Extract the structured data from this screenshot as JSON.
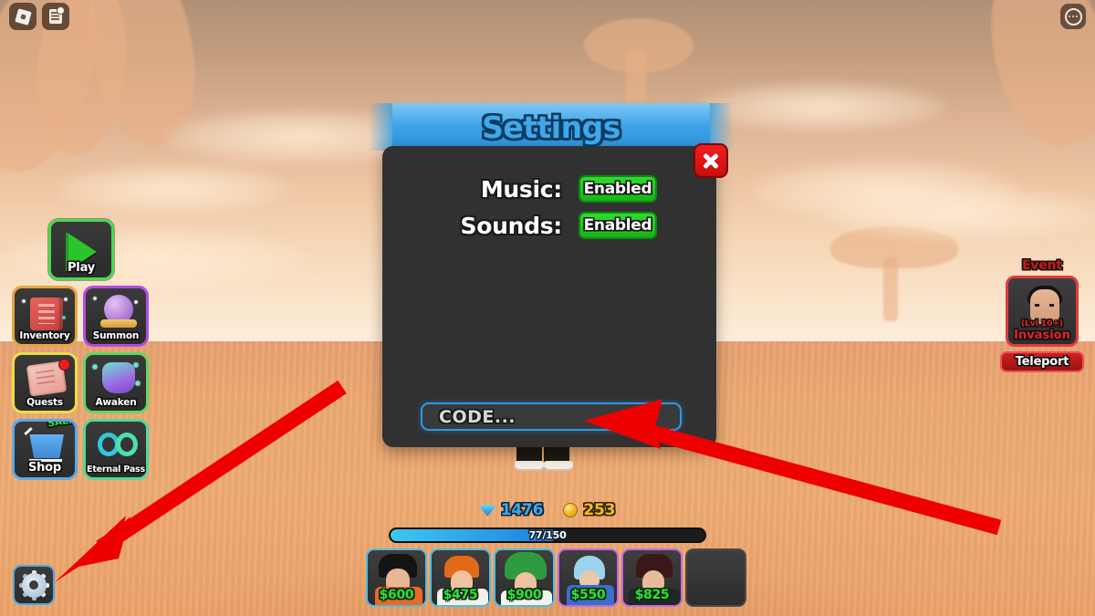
{
  "window": {
    "game_genre": "roblox-anime-tower-defense",
    "topbar": {
      "roblox_logo": "roblox-logo-icon",
      "chat_icon": "chat-icon",
      "more_icon": "more-options-icon"
    }
  },
  "left_menu": {
    "buttons": [
      {
        "label": "Play",
        "icon": "play-triangle-icon",
        "accent": "#49D94F"
      },
      {
        "label": "Inventory",
        "icon": "inventory-book-icon",
        "accent": "#E6A63F"
      },
      {
        "label": "Summon",
        "icon": "summon-orb-icon",
        "accent": "#B44CE0"
      },
      {
        "label": "Quests",
        "icon": "quest-scroll-icon",
        "accent": "#E7DE4B",
        "badge": "notification-dot"
      },
      {
        "label": "Awaken",
        "icon": "awaken-potion-icon",
        "accent": "#5BD962"
      },
      {
        "label": "Shop",
        "icon": "shop-cart-icon",
        "accent": "#5CA8E8",
        "badge_text": "SALE!"
      },
      {
        "label": "Eternal Pass",
        "icon": "infinity-icon",
        "accent": "#4FD99B"
      }
    ]
  },
  "event_panel": {
    "title": "Event",
    "level_req": "(Lvl 10+)",
    "name": "Invasion",
    "teleport_label": "Teleport",
    "accent": "#E03A3A"
  },
  "settings_dialog": {
    "title": "Settings",
    "close_label": "close-button",
    "rows": [
      {
        "label": "Music:",
        "value": "Enabled"
      },
      {
        "label": "Sounds:",
        "value": "Enabled"
      }
    ],
    "code_input": {
      "placeholder": "CODE...",
      "value": "",
      "border_color": "#2A9BE8"
    },
    "panel_color": "#313131",
    "banner_color": "#3DA4E8",
    "enabled_color": "#22C822"
  },
  "bottom_hud": {
    "currencies": [
      {
        "icon": "gem-icon",
        "value": "1476",
        "color": "#3FA9E8"
      },
      {
        "icon": "coin-icon",
        "value": "253",
        "color": "#F0BD24"
      }
    ],
    "xp_bar": {
      "text": "77/150",
      "current": 77,
      "max": 150,
      "percent": 52
    },
    "unit_slots": [
      {
        "price": "$600",
        "rarity_color": "#4DBEE0",
        "unit": "unit-black-hair"
      },
      {
        "price": "$475",
        "rarity_color": "#4DBEE0",
        "unit": "unit-orange-hair"
      },
      {
        "price": "$900",
        "rarity_color": "#4DBEE0",
        "unit": "unit-green-hair"
      },
      {
        "price": "$550",
        "rarity_color": "#C268E8",
        "unit": "unit-blue-hood"
      },
      {
        "price": "$825",
        "rarity_color": "#C268E8",
        "unit": "unit-dark-red-hair"
      },
      {
        "price": "",
        "rarity_color": "#4A4A4A",
        "unit": "empty-slot"
      }
    ]
  },
  "settings_button": {
    "icon": "gear-icon",
    "accent": "#4FA8DC"
  },
  "annotations": {
    "arrow_color": "#EE0000",
    "arrows": [
      {
        "name": "arrow-to-settings-gear",
        "points_to": "settings-gear-button"
      },
      {
        "name": "arrow-to-code-field",
        "points_to": "code-input-field"
      }
    ]
  }
}
